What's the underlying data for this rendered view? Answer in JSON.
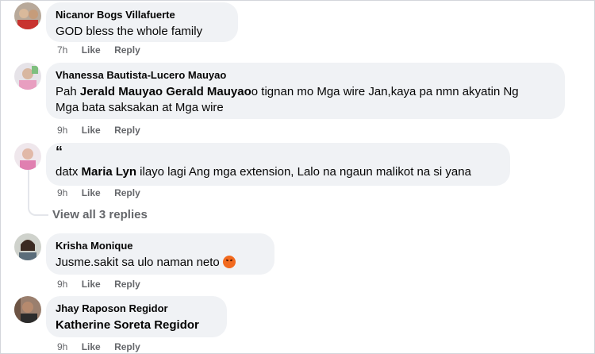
{
  "comments": [
    {
      "author": "Nicanor Bogs Villafuerte",
      "text": "GOD bless the whole family",
      "time": "7h",
      "like": "Like",
      "reply": "Reply"
    },
    {
      "author": "Vhanessa Bautista-Lucero Mauyao",
      "text_prefix": "Pah ",
      "mention1": "Jerald Mauyao",
      "space": " ",
      "mention2": "Gerald Mauyao",
      "text_suffix_line1": "o tignan mo Mga wire Jan,kaya pa nmn akyatin Ng",
      "text_line2": "Mga bata saksakan at Mga wire",
      "time": "9h",
      "like": "Like",
      "reply": "Reply"
    },
    {
      "author": "“",
      "text_prefix": "datx ",
      "mention": "Maria Lyn",
      "text_suffix": " ilayo lagi Ang mga extension, Lalo na ngaun malikot na si yana",
      "time": "9h",
      "like": "Like",
      "reply": "Reply"
    },
    {
      "author": "Krisha Monique",
      "text": "Jusme.sakit sa ulo naman neto",
      "emoji": "angry-face",
      "time": "9h",
      "like": "Like",
      "reply": "Reply"
    },
    {
      "author": "Jhay Raposon Regidor",
      "mention": "Katherine Soreta Regidor",
      "time": "9h",
      "like": "Like",
      "reply": "Reply"
    }
  ],
  "view_replies": "View all 3 replies",
  "colors": {
    "bubble": "#f0f2f5",
    "meta": "#65676b",
    "text": "#050505"
  }
}
